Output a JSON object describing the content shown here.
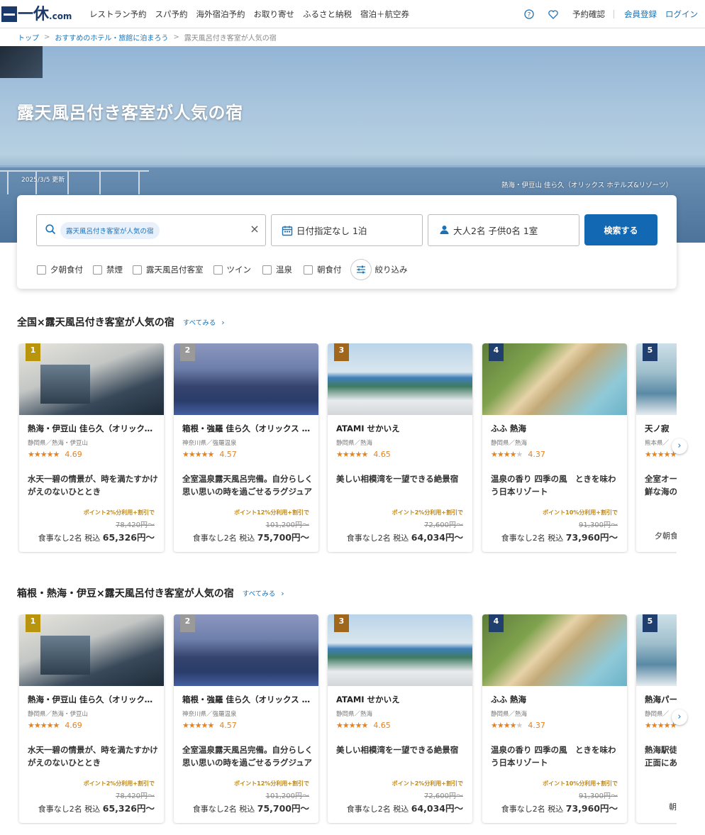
{
  "header": {
    "logo_text": "一休",
    "logo_suffix": ".com",
    "nav": [
      "レストラン予約",
      "スパ予約",
      "海外宿泊予約",
      "お取り寄せ",
      "ふるさと納税",
      "宿泊＋航空券"
    ],
    "reservation_check": "予約確認",
    "register": "会員登録",
    "login": "ログイン"
  },
  "breadcrumb": [
    "トップ",
    "おすすめのホテル・旅館に泊まろう",
    "露天風呂付き客室が人気の宿"
  ],
  "hero": {
    "title": "露天風呂付き客室が人気の宿",
    "date": "2025/3/5 更新",
    "caption": "熱海・伊豆山 佳ら久（オリックス ホテルズ&リゾーツ）"
  },
  "search": {
    "keyword_chip": "露天風呂付き客室が人気の宿",
    "date": "日付指定なし 1泊",
    "guests": "大人2名 子供0名 1室",
    "button": "検索する",
    "filters": [
      "夕朝食付",
      "禁煙",
      "露天風呂付客室",
      "ツイン",
      "温泉",
      "朝食付"
    ],
    "narrow": "絞り込み"
  },
  "sections": [
    {
      "title": "全国×露天風呂付き客室が人気の宿",
      "more": "すべてみる",
      "cards": [
        {
          "rank": "1",
          "name": "熱海・伊豆山 佳ら久（オリックス ホテルズ&リゾーツ）",
          "area": "静岡県／熱海・伊豆山",
          "score": "4.69",
          "stars": "★★★★★",
          "desc": "水天一碧の情景が、時を満たすかけがえのないひととき",
          "point": "ポイント2%分利用+割引で",
          "orig": "78,420円～",
          "meal": "食事なし2名 税込",
          "price": "65,326円～"
        },
        {
          "rank": "2",
          "name": "箱根・強羅 佳ら久（オリックス ホテルズ&リゾーツ）",
          "area": "神奈川県／強羅温泉",
          "score": "4.57",
          "stars": "★★★★★",
          "desc": "全室温泉露天風呂完備。自分らしく思い思いの時を過ごせるラグジュアリーリゾート",
          "point": "ポイント12%分利用+割引で",
          "orig": "101,200円～",
          "meal": "食事なし2名 税込",
          "price": "75,700円～"
        },
        {
          "rank": "3",
          "name": "ATAMI せかいえ",
          "area": "静岡県／熱海",
          "score": "4.65",
          "stars": "★★★★★",
          "desc": "美しい相模湾を一望できる絶景宿",
          "point": "ポイント2%分利用+割引で",
          "orig": "72,600円～",
          "meal": "食事なし2名 税込",
          "price": "64,034円～"
        },
        {
          "rank": "4",
          "name": "ふふ 熱海",
          "area": "静岡県／熱海",
          "score": "4.37",
          "stars": "★★★★",
          "desc": "温泉の香り 四季の風　ときを味わう日本リゾート",
          "point": "ポイント10%分利用+割引で",
          "orig": "91,300円～",
          "meal": "食事なし2名 税込",
          "price": "73,960円～"
        },
        {
          "rank": "5",
          "name": "天ノ寂",
          "area": "熊本県／",
          "score": "",
          "stars": "★★★★★",
          "desc": "全室オー鮮な海の",
          "point": "",
          "orig": "",
          "meal": "夕朝食",
          "price": ""
        }
      ]
    },
    {
      "title": "箱根・熱海・伊豆×露天風呂付き客室が人気の宿",
      "more": "すべてみる",
      "cards": [
        {
          "rank": "1",
          "name": "熱海・伊豆山 佳ら久（オリックス ホテルズ&リゾーツ）",
          "area": "静岡県／熱海・伊豆山",
          "score": "4.69",
          "stars": "★★★★★",
          "desc": "水天一碧の情景が、時を満たすかけがえのないひととき",
          "point": "ポイント2%分利用+割引で",
          "orig": "78,420円～",
          "meal": "食事なし2名 税込",
          "price": "65,326円～"
        },
        {
          "rank": "2",
          "name": "箱根・強羅 佳ら久（オリックス ホテルズ&リゾーツ）",
          "area": "神奈川県／強羅温泉",
          "score": "4.57",
          "stars": "★★★★★",
          "desc": "全室温泉露天風呂完備。自分らしく思い思いの時を過ごせるラグジュアリーリゾート",
          "point": "ポイント12%分利用+割引で",
          "orig": "101,200円～",
          "meal": "食事なし2名 税込",
          "price": "75,700円～"
        },
        {
          "rank": "3",
          "name": "ATAMI せかいえ",
          "area": "静岡県／熱海",
          "score": "4.65",
          "stars": "★★★★★",
          "desc": "美しい相模湾を一望できる絶景宿",
          "point": "ポイント2%分利用+割引で",
          "orig": "72,600円～",
          "meal": "食事なし2名 税込",
          "price": "64,034円～"
        },
        {
          "rank": "4",
          "name": "ふふ 熱海",
          "area": "静岡県／熱海",
          "score": "4.37",
          "stars": "★★★★",
          "desc": "温泉の香り 四季の風　ときを味わう日本リゾート",
          "point": "ポイント10%分利用+割引で",
          "orig": "91,300円～",
          "meal": "食事なし2名 税込",
          "price": "73,960円～"
        },
        {
          "rank": "5",
          "name": "熱海パー",
          "area": "静岡県／",
          "score": "",
          "stars": "★★★★★",
          "desc": "熱海駅徒正面にあ",
          "point": "",
          "orig": "",
          "meal": "朝",
          "price": ""
        }
      ]
    }
  ]
}
